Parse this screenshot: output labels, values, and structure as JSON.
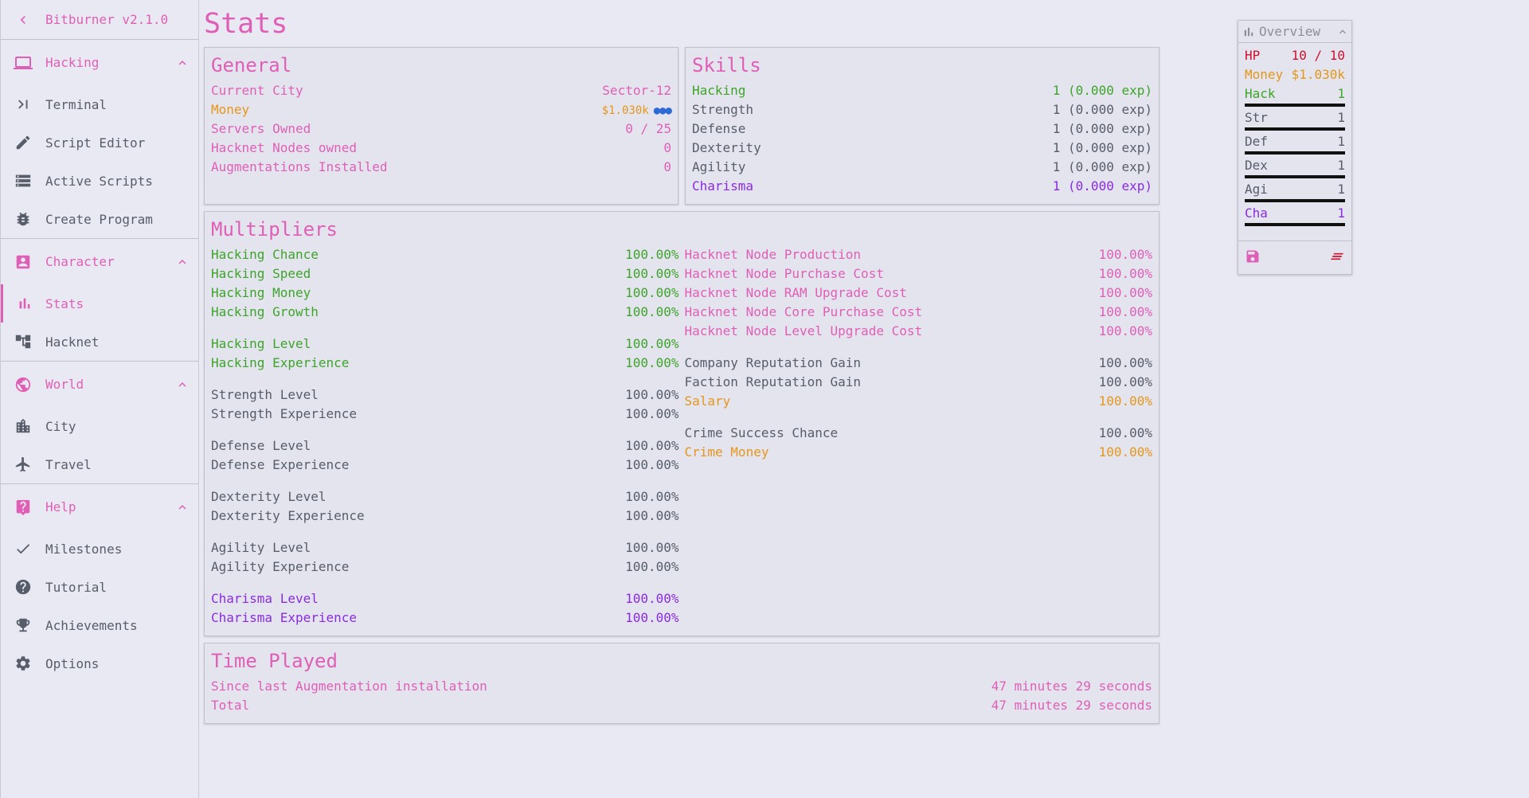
{
  "app": {
    "title": "Bitburner v2.1.0"
  },
  "sidebar": {
    "sections": [
      {
        "label": "Hacking",
        "items": [
          "Terminal",
          "Script Editor",
          "Active Scripts",
          "Create Program"
        ]
      },
      {
        "label": "Character",
        "items": [
          "Stats",
          "Hacknet"
        ]
      },
      {
        "label": "World",
        "items": [
          "City",
          "Travel"
        ]
      },
      {
        "label": "Help",
        "items": [
          "Milestones",
          "Tutorial",
          "Achievements",
          "Options"
        ]
      }
    ],
    "active": "Stats"
  },
  "page": {
    "title": "Stats"
  },
  "general": {
    "title": "General",
    "rows": [
      {
        "label": "Current City",
        "value": "Sector-12"
      },
      {
        "label": "Money",
        "value": "$1.030k"
      },
      {
        "label": "Servers Owned",
        "value": "0 / 25"
      },
      {
        "label": "Hacknet Nodes owned",
        "value": "0"
      },
      {
        "label": "Augmentations Installed",
        "value": "0"
      }
    ]
  },
  "skills": {
    "title": "Skills",
    "rows": [
      {
        "label": "Hacking",
        "value": "1 (0.000 exp)"
      },
      {
        "label": "Strength",
        "value": "1 (0.000 exp)"
      },
      {
        "label": "Defense",
        "value": "1 (0.000 exp)"
      },
      {
        "label": "Dexterity",
        "value": "1 (0.000 exp)"
      },
      {
        "label": "Agility",
        "value": "1 (0.000 exp)"
      },
      {
        "label": "Charisma",
        "value": "1 (0.000 exp)"
      }
    ]
  },
  "multipliers": {
    "title": "Multipliers",
    "left": [
      {
        "label": "Hacking Chance",
        "value": "100.00%"
      },
      {
        "label": "Hacking Speed",
        "value": "100.00%"
      },
      {
        "label": "Hacking Money",
        "value": "100.00%"
      },
      {
        "label": "Hacking Growth",
        "value": "100.00%"
      },
      {
        "label": "Hacking Level",
        "value": "100.00%"
      },
      {
        "label": "Hacking Experience",
        "value": "100.00%"
      },
      {
        "label": "Strength Level",
        "value": "100.00%"
      },
      {
        "label": "Strength Experience",
        "value": "100.00%"
      },
      {
        "label": "Defense Level",
        "value": "100.00%"
      },
      {
        "label": "Defense Experience",
        "value": "100.00%"
      },
      {
        "label": "Dexterity Level",
        "value": "100.00%"
      },
      {
        "label": "Dexterity Experience",
        "value": "100.00%"
      },
      {
        "label": "Agility Level",
        "value": "100.00%"
      },
      {
        "label": "Agility Experience",
        "value": "100.00%"
      },
      {
        "label": "Charisma Level",
        "value": "100.00%"
      },
      {
        "label": "Charisma Experience",
        "value": "100.00%"
      }
    ],
    "right": [
      {
        "label": "Hacknet Node Production",
        "value": "100.00%"
      },
      {
        "label": "Hacknet Node Purchase Cost",
        "value": "100.00%"
      },
      {
        "label": "Hacknet Node RAM Upgrade Cost",
        "value": "100.00%"
      },
      {
        "label": "Hacknet Node Core Purchase Cost",
        "value": "100.00%"
      },
      {
        "label": "Hacknet Node Level Upgrade Cost",
        "value": "100.00%"
      },
      {
        "label": "Company Reputation Gain",
        "value": "100.00%"
      },
      {
        "label": "Faction Reputation Gain",
        "value": "100.00%"
      },
      {
        "label": "Salary",
        "value": "100.00%"
      },
      {
        "label": "Crime Success Chance",
        "value": "100.00%"
      },
      {
        "label": "Crime Money",
        "value": "100.00%"
      }
    ]
  },
  "time_played": {
    "title": "Time Played",
    "rows": [
      {
        "label": "Since last Augmentation installation",
        "value": "47 minutes 29 seconds"
      },
      {
        "label": "Total",
        "value": "47 minutes 29 seconds"
      }
    ]
  },
  "overview": {
    "title": "Overview",
    "hp": {
      "label": "HP",
      "value": "10 / 10"
    },
    "money": {
      "label": "Money",
      "value": "$1.030k"
    },
    "stats": [
      {
        "label": "Hack",
        "value": "1"
      },
      {
        "label": "Str",
        "value": "1"
      },
      {
        "label": "Def",
        "value": "1"
      },
      {
        "label": "Dex",
        "value": "1"
      },
      {
        "label": "Agi",
        "value": "1"
      },
      {
        "label": "Cha",
        "value": "1"
      }
    ]
  },
  "colors": {
    "accent": "#e05fb6",
    "hack": "#3ea42a",
    "cha": "#8a2be2",
    "money": "#e5961b",
    "hp": "#d0102e"
  }
}
